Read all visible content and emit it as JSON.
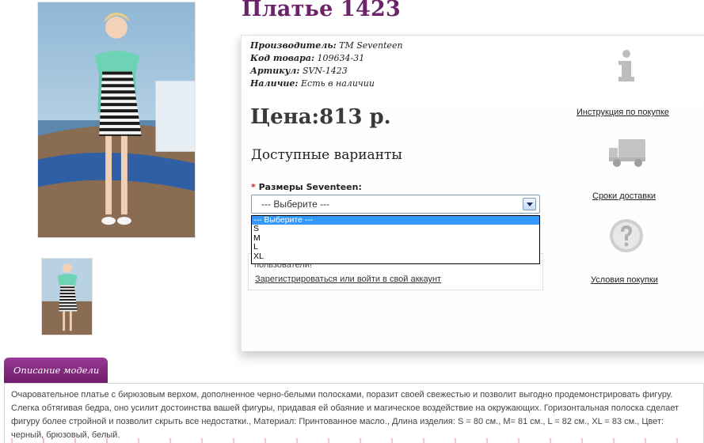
{
  "product": {
    "title": "Платье 1423",
    "specs": [
      {
        "label": "Производитель:",
        "value": "TM Seventeen"
      },
      {
        "label": "Код товара:",
        "value": "109634-31"
      },
      {
        "label": "Артикул:",
        "value": "SVN-1423"
      },
      {
        "label": "Наличие:",
        "value": "Есть в наличии"
      }
    ],
    "price_label": "Цена:",
    "price_value": "813 р."
  },
  "options": {
    "title": "Доступные варианты",
    "size_required_mark": "*",
    "size_label": "Размеры Seventeen:",
    "selected": "--- Выберите ---",
    "list": [
      "--- Выберите ---",
      "S",
      "M",
      "L",
      "XL"
    ]
  },
  "login": {
    "note": "пользователи!",
    "link": "Зарегистрироваться или войти в свой аккаунт"
  },
  "sidebar": {
    "instructions": "Инструкция по покупке",
    "delivery": "Сроки доставки",
    "terms": "Условия покупки"
  },
  "description": {
    "tab_label": "Описание модели",
    "text": "Очаровательное платье с бирюзовым верхом, дополненное черно-белыми полосками, поразит своей свежестью и позволит выгодно продемонстрировать фигуру. Слегка обтягивая бедра, оно усилит достоинства вашей фигуры, придавая ей обаяние и магическое воздействие на окружающих. Горизонтальная полоска сделает фигуру более стройной и позволит скрыть все недостатки., Материал: Принтованное масло., Длина изделия: S = 80 см., M= 81 см., L = 82 см., XL = 83 см., Цвет: черный, брюзовый, белый."
  },
  "colors": {
    "title": "#6b2469",
    "tab": "#7e2579",
    "select_highlight": "#3399ff",
    "icon_gray": "#bdbdbd"
  },
  "icons": [
    "info-icon",
    "delivery-truck-icon",
    "question-icon",
    "select-arrow-icon"
  ]
}
